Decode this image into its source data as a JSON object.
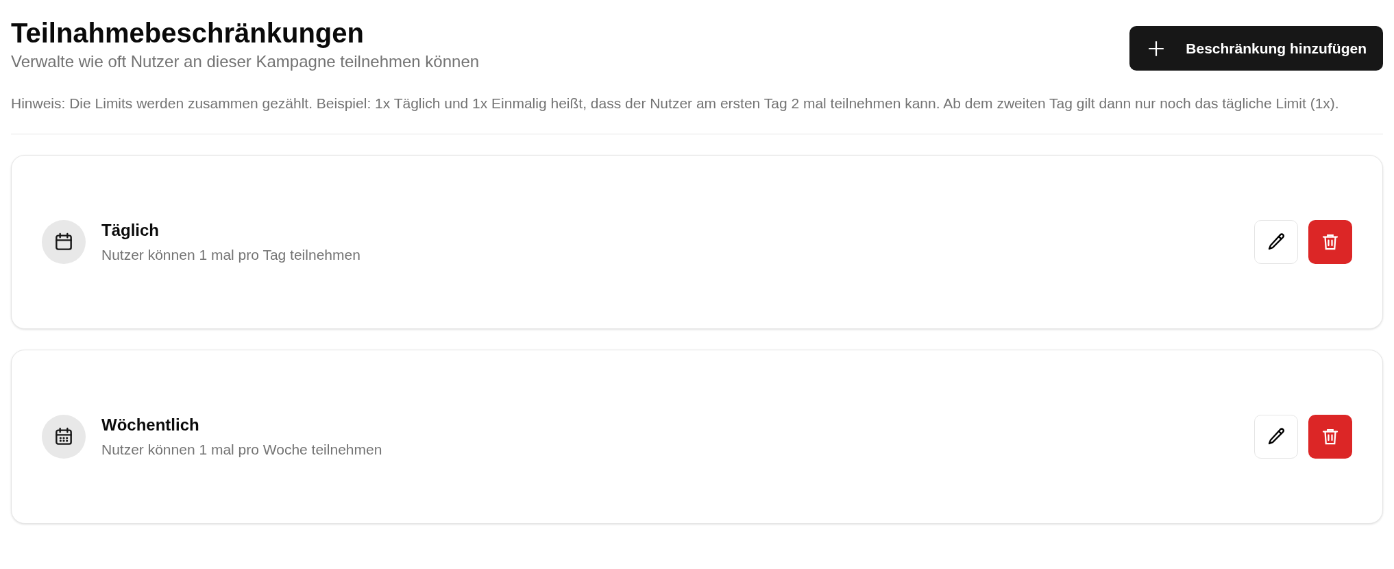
{
  "header": {
    "title": "Teilnahmebeschränkungen",
    "subtitle": "Verwalte wie oft Nutzer an dieser Kampagne teilnehmen können",
    "add_button": "Beschränkung hinzufügen"
  },
  "hint": "Hinweis: Die Limits werden zusammen gezählt. Beispiel: 1x Täglich und 1x Einmalig heißt, dass der Nutzer am ersten Tag 2 mal teilnehmen kann. Ab dem zweiten Tag gilt dann nur noch das tägliche Limit (1x).",
  "restrictions": [
    {
      "kind": "daily",
      "title": "Täglich",
      "description": "Nutzer können 1 mal pro Tag teilnehmen"
    },
    {
      "kind": "weekly",
      "title": "Wöchentlich",
      "description": "Nutzer können 1 mal pro Woche teilnehmen"
    }
  ]
}
